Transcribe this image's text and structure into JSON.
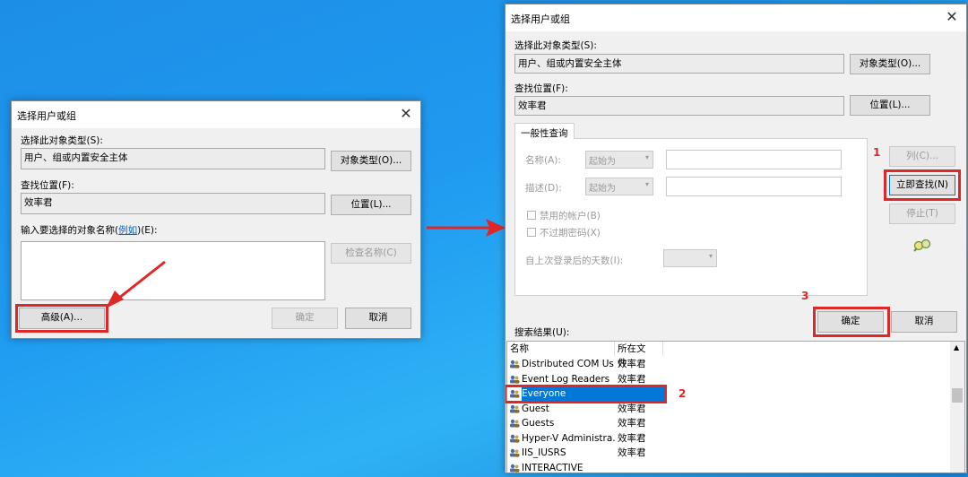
{
  "left_dialog": {
    "title": "选择用户或组",
    "object_type_label": "选择此对象类型(S):",
    "object_type_value": "用户、组或内置安全主体",
    "object_type_button": "对象类型(O)...",
    "location_label": "查找位置(F):",
    "location_value": "效率君",
    "location_button": "位置(L)...",
    "enter_names_prefix": "输入要选择的对象名称(",
    "enter_names_link": "例如",
    "enter_names_suffix": ")(E):",
    "check_names_button": "检查名称(C)",
    "advanced_button": "高级(A)...",
    "ok_button": "确定",
    "cancel_button": "取消"
  },
  "right_dialog": {
    "title": "选择用户或组",
    "object_type_label": "选择此对象类型(S):",
    "object_type_value": "用户、组或内置安全主体",
    "object_type_button": "对象类型(O)...",
    "location_label": "查找位置(F):",
    "location_value": "效率君",
    "location_button": "位置(L)...",
    "tab_label": "一般性查询",
    "name_label": "名称(A):",
    "name_dropdown": "起始为",
    "desc_label": "描述(D):",
    "desc_dropdown": "起始为",
    "disabled_accounts": "禁用的帐户(B)",
    "non_expiring_pw": "不过期密码(X)",
    "days_since_logon": "自上次登录后的天数(I):",
    "columns_button": "列(C)...",
    "find_now_button": "立即查找(N)",
    "stop_button": "停止(T)",
    "ok_button": "确定",
    "cancel_button": "取消",
    "results_label": "搜索结果(U):",
    "col_name": "名称",
    "col_location": "所在文件...",
    "rows": [
      {
        "name": "Distributed COM Us...",
        "location": "效率君"
      },
      {
        "name": "Event Log Readers",
        "location": "效率君"
      },
      {
        "name": "Everyone",
        "location": ""
      },
      {
        "name": "Guest",
        "location": "效率君"
      },
      {
        "name": "Guests",
        "location": "效率君"
      },
      {
        "name": "Hyper-V Administra...",
        "location": "效率君"
      },
      {
        "name": "IIS_IUSRS",
        "location": "效率君"
      },
      {
        "name": "INTERACTIVE",
        "location": ""
      }
    ]
  },
  "annotations": {
    "step1": "1",
    "step2": "2",
    "step3": "3"
  },
  "colors": {
    "highlight": "#e02727",
    "selection": "#0078d7",
    "desktop": "#1f9af0"
  }
}
